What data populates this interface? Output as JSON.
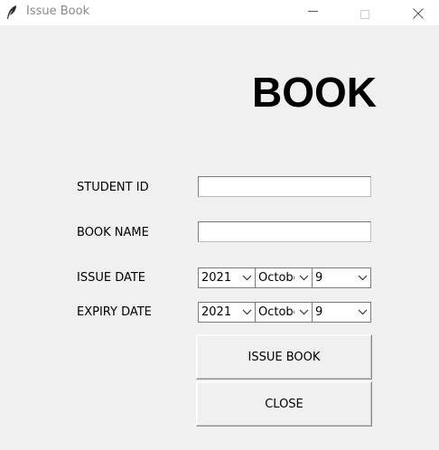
{
  "window": {
    "title": "Issue Book"
  },
  "form": {
    "heading": "BOOK",
    "student_id": {
      "label": "STUDENT ID",
      "value": ""
    },
    "book_name": {
      "label": "BOOK NAME",
      "value": ""
    },
    "issue_date": {
      "label": "ISSUE DATE",
      "year": "2021",
      "month": "October",
      "day": "9"
    },
    "expiry_date": {
      "label": "EXPIRY DATE",
      "year": "2021",
      "month": "October",
      "day": "9"
    }
  },
  "buttons": {
    "issue_label": "ISSUE BOOK",
    "close_label": "CLOSE"
  }
}
